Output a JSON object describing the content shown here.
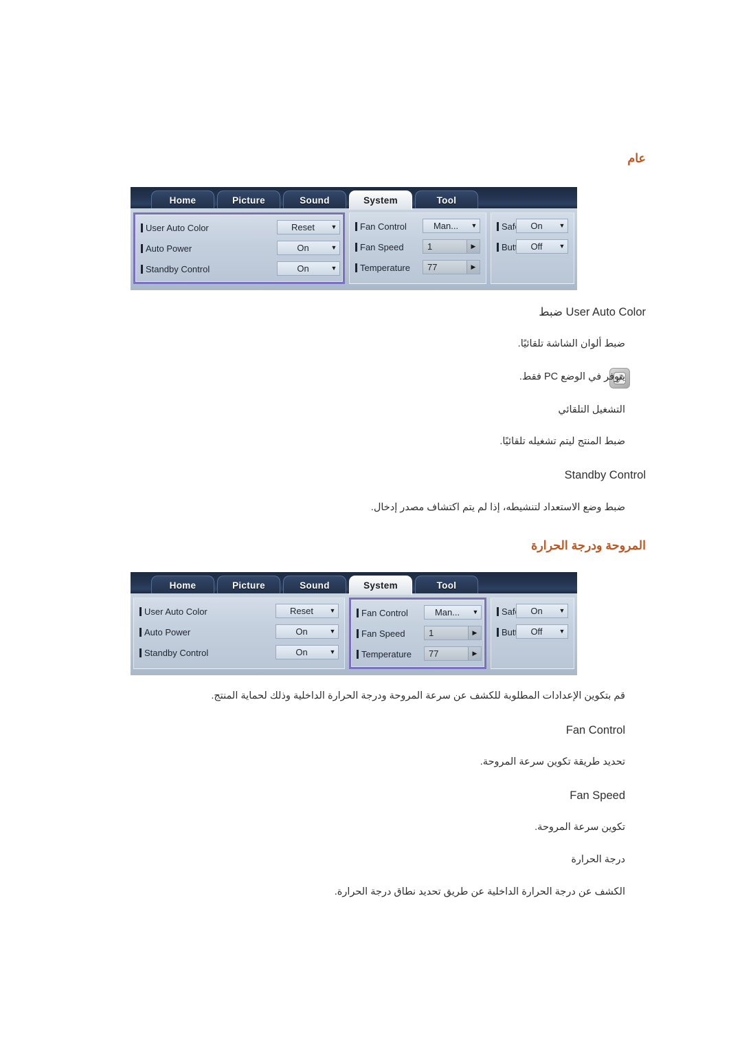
{
  "document": {
    "language": "ar",
    "accent_color": "#c0551e",
    "highlight_color": "#7b6fc0"
  },
  "sections": [
    {
      "heading": "عام",
      "lines": [
        "ضبط User Auto Color",
        "ضبط ألوان الشاشة تلقائيًا.",
        "يتوفر في الوضع PC فقط.",
        "التشغيل التلقائي",
        "ضبط المنتج ليتم تشغيله تلقائيًا.",
        "Standby Control",
        "ضبط وضع الاستعداد لتنشيطه، إذا لم يتم اكتشاف مصدر إدخال."
      ]
    },
    {
      "heading": "المروحة ودرجة الحرارة",
      "lines": [
        "قم بتكوين الإعدادات المطلوبة للكشف عن سرعة المروحة ودرجة الحرارة الداخلية وذلك لحماية المنتج.",
        "Fan Control",
        "تحديد طريقة تكوين سرعة المروحة.",
        "Fan Speed",
        "تكوين سرعة المروحة.",
        "درجة الحرارة",
        "الكشف عن درجة الحرارة الداخلية عن طريق تحديد نطاق درجة الحرارة."
      ]
    }
  ],
  "note_icon_label": "note-icon",
  "osd": {
    "tabs": [
      {
        "label": "Home",
        "active": false
      },
      {
        "label": "Picture",
        "active": false
      },
      {
        "label": "Sound",
        "active": false
      },
      {
        "label": "System",
        "active": true
      },
      {
        "label": "Tool",
        "active": false
      }
    ],
    "columns": [
      {
        "name": "general-column",
        "rows": [
          {
            "label": "User Auto Color",
            "value": "Reset",
            "control": "dropdown"
          },
          {
            "label": "Auto Power",
            "value": "On",
            "control": "dropdown"
          },
          {
            "label": "Standby Control",
            "value": "On",
            "control": "dropdown"
          }
        ]
      },
      {
        "name": "fan-temperature-column",
        "rows": [
          {
            "label": "Fan Control",
            "value": "Man...",
            "control": "dropdown"
          },
          {
            "label": "Fan Speed",
            "value": "1",
            "control": "spinner"
          },
          {
            "label": "Temperature",
            "value": "77",
            "control": "spinner"
          }
        ]
      },
      {
        "name": "lock-column",
        "rows": [
          {
            "label": "Safety Lock",
            "value": "On",
            "control": "dropdown"
          },
          {
            "label": "Button Lock",
            "value": "Off",
            "control": "dropdown"
          }
        ]
      }
    ],
    "caret_glyph": "▼",
    "spin_glyph": "▶"
  },
  "panel_1": {
    "highlighted_column": 0
  },
  "panel_2": {
    "highlighted_column": 1
  }
}
